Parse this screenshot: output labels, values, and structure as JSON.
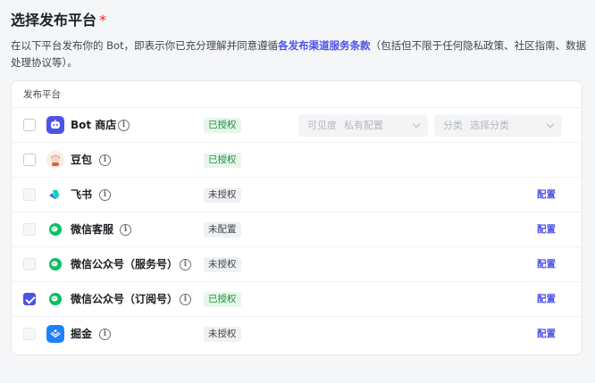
{
  "section": {
    "title": "选择发布平台",
    "required_mark": "*",
    "desc_before": "在以下平台发布你的 Bot，即表示你已充分理解并同意遵循",
    "desc_link": "各发布渠道服务条款",
    "desc_after": "（包括但不限于任何隐私政策、社区指南、数据处理协议等）。"
  },
  "table": {
    "header": "发布平台",
    "config_label": "配置",
    "visibility_select": {
      "label": "可见度",
      "value": "私有配置"
    },
    "category_select": {
      "label": "分类",
      "placeholder": "选择分类"
    },
    "rows": [
      {
        "name": "Bot 商店",
        "status": "已授权",
        "checked": false,
        "disabled": false,
        "has_config": false
      },
      {
        "name": "豆包",
        "status": "已授权",
        "checked": false,
        "disabled": false,
        "has_config": false
      },
      {
        "name": "飞书",
        "status": "未授权",
        "checked": false,
        "disabled": true,
        "has_config": true
      },
      {
        "name": "微信客服",
        "status": "未配置",
        "checked": false,
        "disabled": true,
        "has_config": true
      },
      {
        "name": "微信公众号（服务号）",
        "status": "未授权",
        "checked": false,
        "disabled": true,
        "has_config": true
      },
      {
        "name": "微信公众号（订阅号）",
        "status": "已授权",
        "checked": true,
        "disabled": false,
        "has_config": true
      },
      {
        "name": "掘金",
        "status": "未授权",
        "checked": false,
        "disabled": true,
        "has_config": true
      }
    ]
  },
  "colors": {
    "accent": "#4d53e8",
    "authorized_bg": "#e6f7ea",
    "authorized_text": "#1e8e3e",
    "required": "#f5222d"
  },
  "icons": {
    "info": "i",
    "bot_store": "bot-store-icon",
    "doubao": "doubao-avatar-icon",
    "feishu": "feishu-icon",
    "wechat": "wechat-icon",
    "juejin": "juejin-icon"
  }
}
